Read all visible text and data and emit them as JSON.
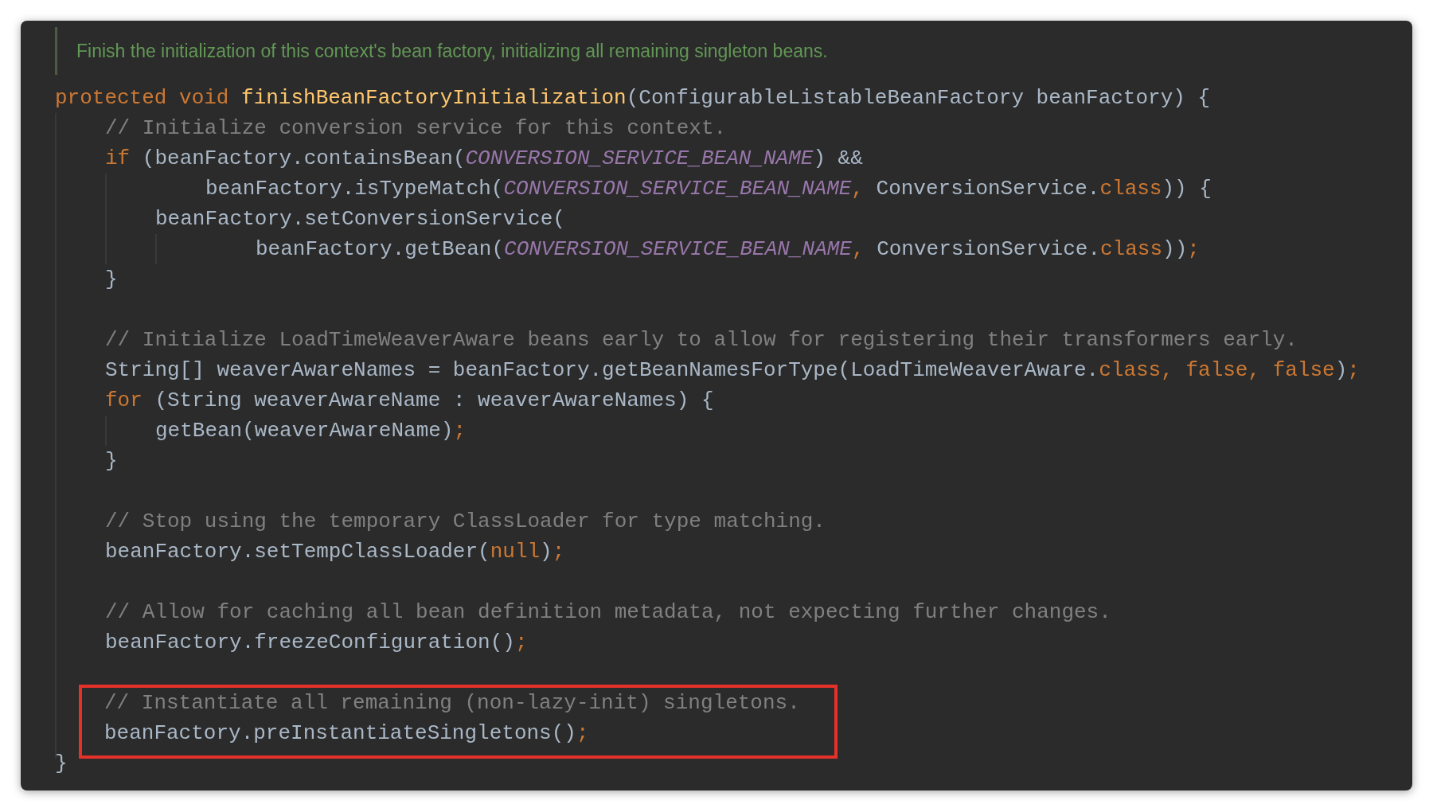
{
  "doc_comment": "Finish the initialization of this context's bean factory, initializing all remaining singleton beans.",
  "code": [
    {
      "kind": "code",
      "tokens": [
        {
          "text": "protected void ",
          "kind": "keyword"
        },
        {
          "text": "finishBeanFactoryInitialization",
          "kind": "function"
        },
        {
          "text": "(ConfigurableListableBeanFactory beanFactory) {",
          "kind": "plain"
        }
      ],
      "children": [
        {
          "kind": "code",
          "highlighted": false,
          "tokens": [
            {
              "text": "// Initialize conversion service for this context.",
              "kind": "comment"
            }
          ]
        },
        {
          "kind": "code",
          "highlighted": false,
          "tokens": [
            {
              "text": "if",
              "kind": "keyword"
            },
            {
              "text": " (beanFactory.containsBean(",
              "kind": "plain"
            },
            {
              "text": "CONVERSION_SERVICE_BEAN_NAME",
              "kind": "constant"
            },
            {
              "text": ") &&",
              "kind": "plain"
            }
          ],
          "children": [
            {
              "kind": "continuation",
              "tokens": [
                {
                  "text": "beanFactory.isTypeMatch(",
                  "kind": "plain"
                },
                {
                  "text": "CONVERSION_SERVICE_BEAN_NAME",
                  "kind": "constant"
                },
                {
                  "text": ", ",
                  "kind": "punct"
                },
                {
                  "text": "ConversionService.",
                  "kind": "plain"
                },
                {
                  "text": "class",
                  "kind": "keyword"
                },
                {
                  "text": ")) {",
                  "kind": "plain"
                }
              ]
            },
            {
              "kind": "code",
              "tokens": [
                {
                  "text": "beanFactory.setConversionService(",
                  "kind": "plain"
                }
              ],
              "children": [
                {
                  "kind": "continuation",
                  "tokens": [
                    {
                      "text": "beanFactory.getBean(",
                      "kind": "plain"
                    },
                    {
                      "text": "CONVERSION_SERVICE_BEAN_NAME",
                      "kind": "constant"
                    },
                    {
                      "text": ", ",
                      "kind": "punct"
                    },
                    {
                      "text": "ConversionService.",
                      "kind": "plain"
                    },
                    {
                      "text": "class",
                      "kind": "keyword"
                    },
                    {
                      "text": "))",
                      "kind": "plain"
                    },
                    {
                      "text": ";",
                      "kind": "punct"
                    }
                  ]
                }
              ]
            }
          ]
        },
        {
          "kind": "code",
          "highlighted": false,
          "tokens": [
            {
              "text": "}",
              "kind": "plain"
            }
          ]
        },
        {
          "kind": "blank",
          "highlighted": false
        },
        {
          "kind": "code",
          "highlighted": false,
          "tokens": [
            {
              "text": "// Initialize LoadTimeWeaverAware beans early to allow for registering their transformers early.",
              "kind": "comment"
            }
          ]
        },
        {
          "kind": "code",
          "highlighted": false,
          "tokens": [
            {
              "text": "String[] weaverAwareNames = beanFactory.getBeanNamesForType(LoadTimeWeaverAware.",
              "kind": "plain"
            },
            {
              "text": "class, false, false",
              "kind": "keyword"
            },
            {
              "text": ")",
              "kind": "plain"
            },
            {
              "text": ";",
              "kind": "punct"
            }
          ]
        },
        {
          "kind": "code",
          "highlighted": false,
          "tokens": [
            {
              "text": "for",
              "kind": "keyword"
            },
            {
              "text": " (String weaverAwareName : weaverAwareNames) {",
              "kind": "plain"
            }
          ],
          "children": [
            {
              "kind": "code",
              "tokens": [
                {
                  "text": "getBean(weaverAwareName)",
                  "kind": "plain"
                },
                {
                  "text": ";",
                  "kind": "punct"
                }
              ]
            }
          ]
        },
        {
          "kind": "code",
          "highlighted": false,
          "tokens": [
            {
              "text": "}",
              "kind": "plain"
            }
          ]
        },
        {
          "kind": "blank",
          "highlighted": false
        },
        {
          "kind": "code",
          "highlighted": false,
          "tokens": [
            {
              "text": "// Stop using the temporary ClassLoader for type matching.",
              "kind": "comment"
            }
          ]
        },
        {
          "kind": "code",
          "highlighted": false,
          "tokens": [
            {
              "text": "beanFactory.setTempClassLoader(",
              "kind": "plain"
            },
            {
              "text": "null",
              "kind": "keyword"
            },
            {
              "text": ")",
              "kind": "plain"
            },
            {
              "text": ";",
              "kind": "punct"
            }
          ]
        },
        {
          "kind": "blank",
          "highlighted": false
        },
        {
          "kind": "code",
          "highlighted": false,
          "tokens": [
            {
              "text": "// Allow for caching all bean definition metadata, not expecting further changes.",
              "kind": "comment"
            }
          ]
        },
        {
          "kind": "code",
          "highlighted": false,
          "tokens": [
            {
              "text": "beanFactory.freezeConfiguration()",
              "kind": "plain"
            },
            {
              "text": ";",
              "kind": "punct"
            }
          ]
        },
        {
          "kind": "blank",
          "highlighted": false
        },
        {
          "kind": "code",
          "highlighted": true,
          "tokens": [
            {
              "text": "// Instantiate all remaining (non-lazy-init) singletons.",
              "kind": "comment"
            }
          ]
        },
        {
          "kind": "code",
          "highlighted": true,
          "tokens": [
            {
              "text": "beanFactory.preInstantiateSingletons()",
              "kind": "plain"
            },
            {
              "text": ";",
              "kind": "punct"
            }
          ]
        }
      ]
    },
    {
      "kind": "code",
      "tokens": [
        {
          "text": "}",
          "kind": "plain"
        }
      ]
    }
  ]
}
